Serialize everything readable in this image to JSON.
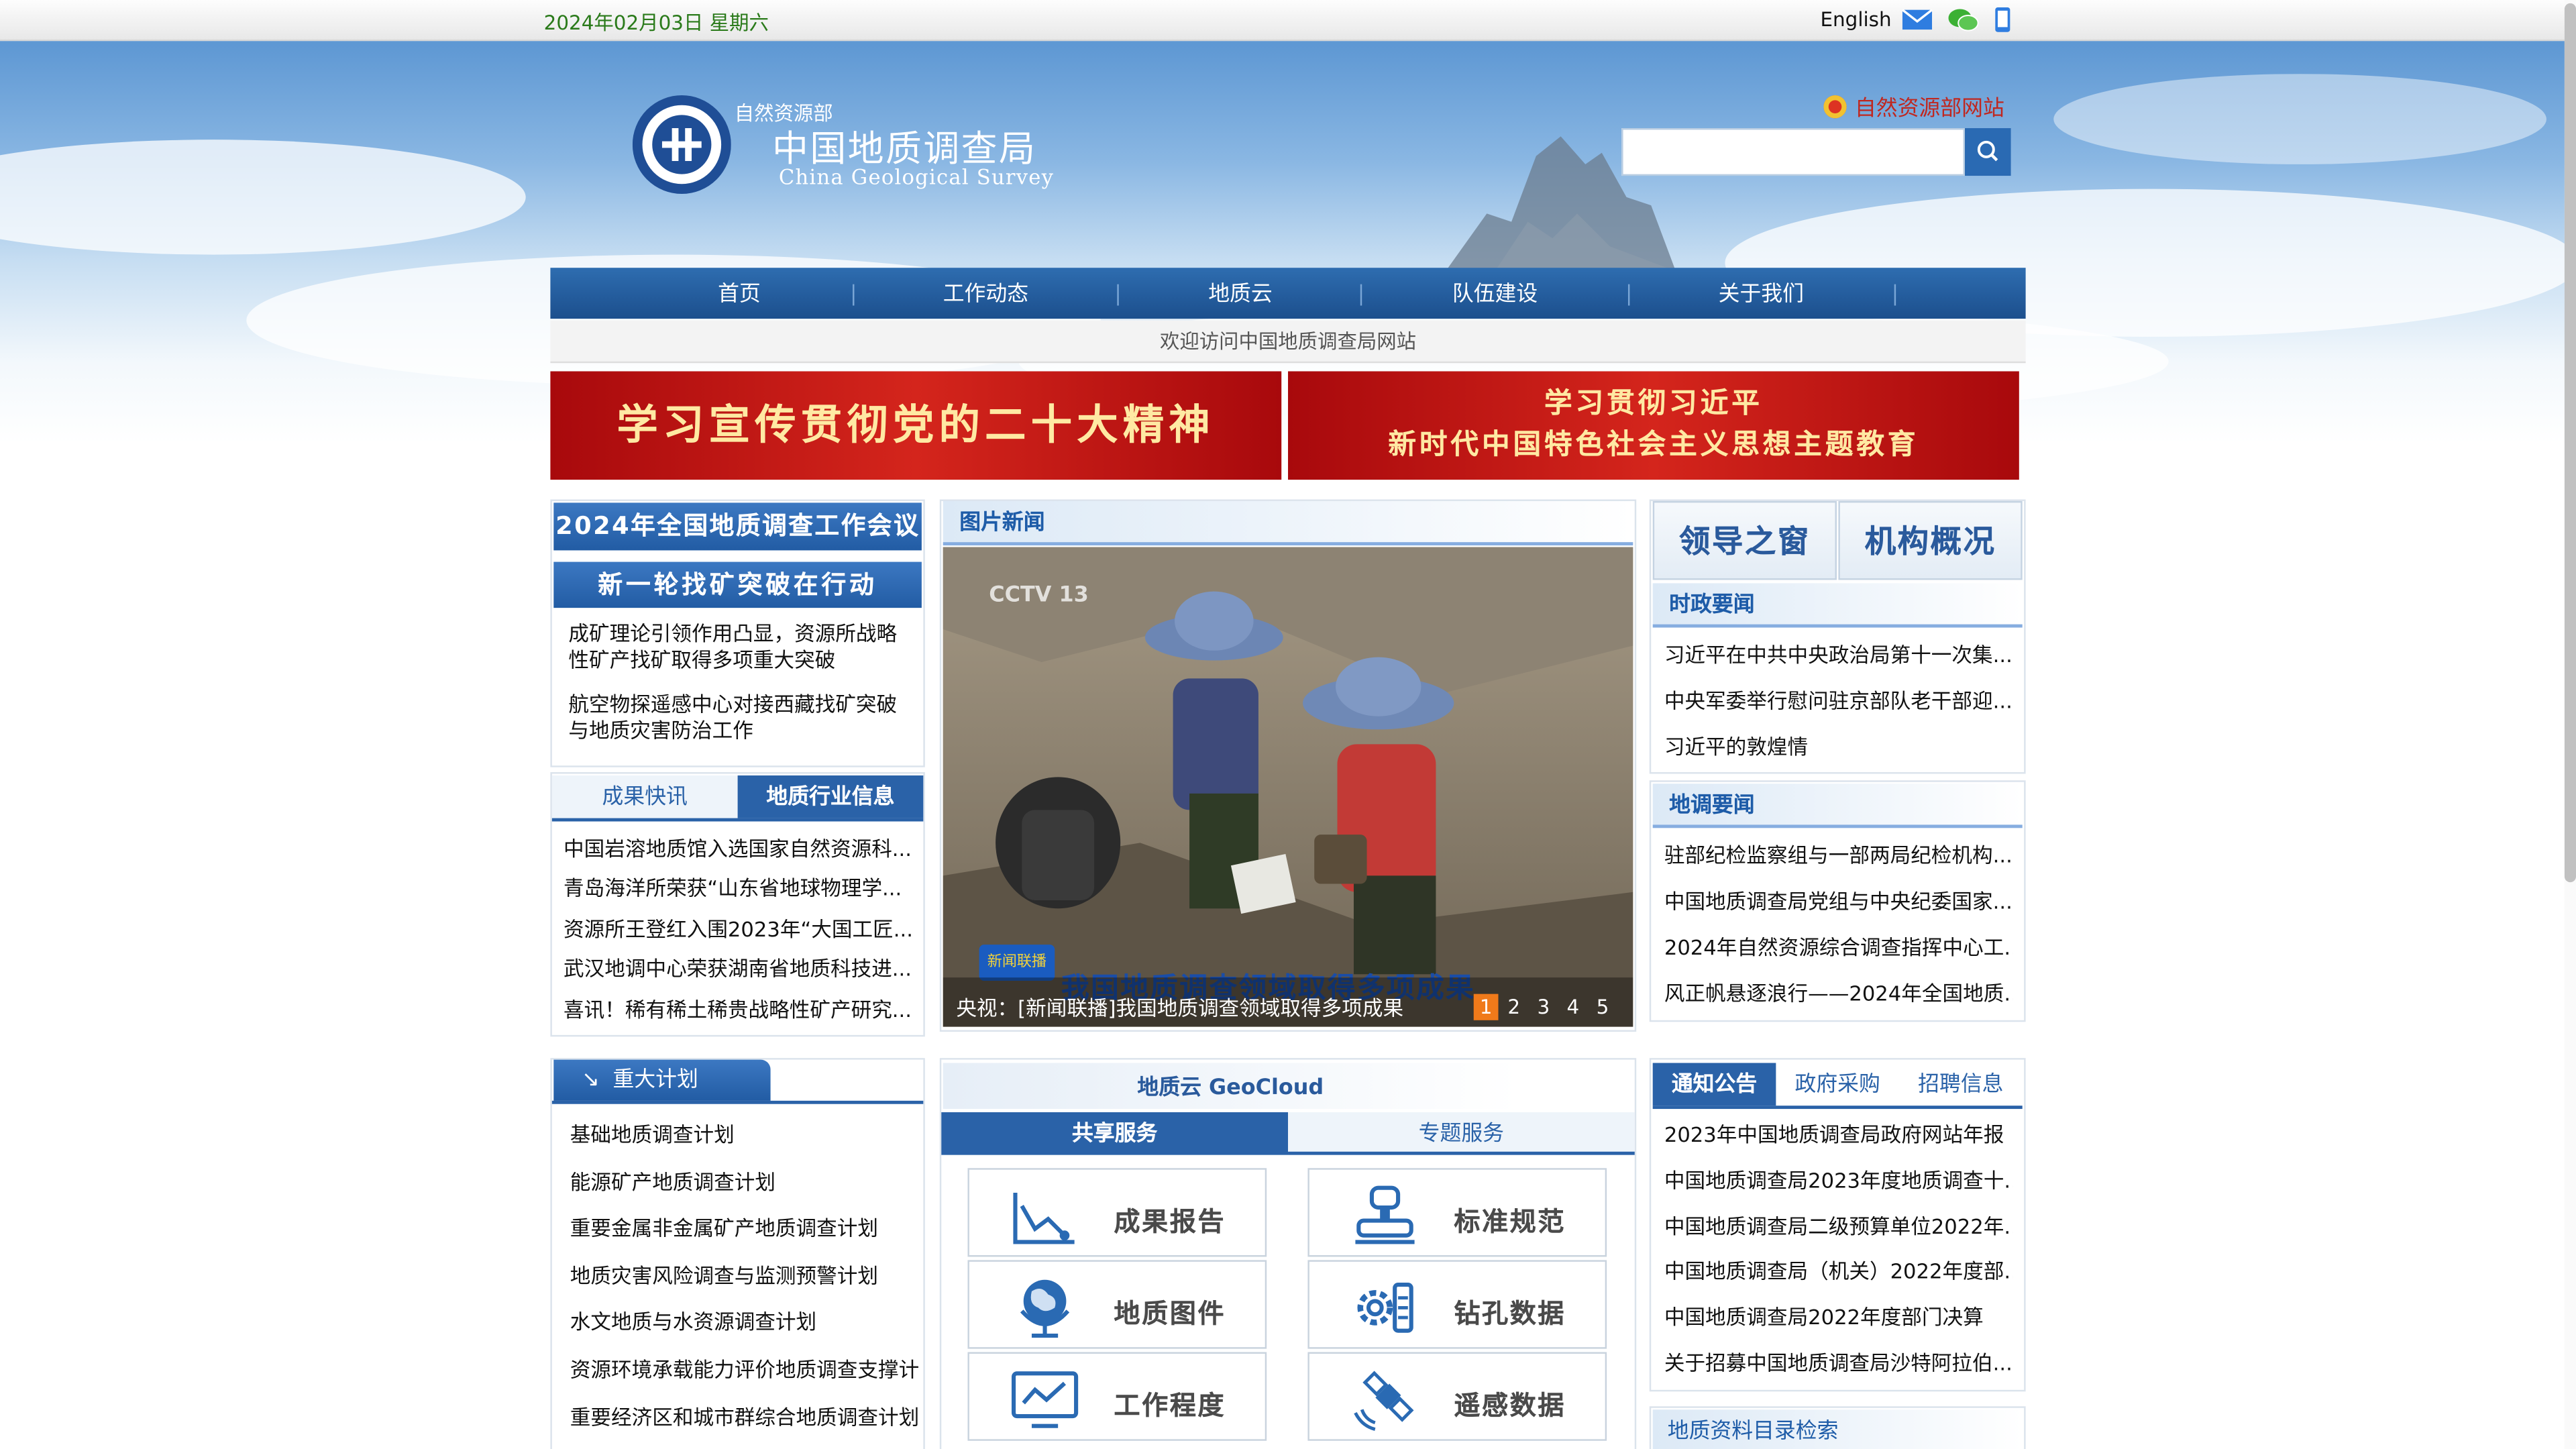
{
  "topbar": {
    "date": "2024年02月03日 星期六",
    "english": "English",
    "icons": [
      "mail-icon",
      "wechat-icon",
      "mobile-icon"
    ]
  },
  "header": {
    "logo_sub": "自然资源部",
    "logo_cn": "中国地质调查局",
    "logo_en": "China Geological Survey",
    "mnr_link": "自然资源部网站",
    "search_placeholder": ""
  },
  "nav": {
    "items": [
      "首页",
      "工作动态",
      "地质云",
      "队伍建设",
      "关于我们"
    ]
  },
  "welcome": "欢迎访问中国地质调查局网站",
  "banners": {
    "left": "学习宣传贯彻党的二十大精神",
    "right_line1": "学习贯彻习近平",
    "right_line2": "新时代中国特色社会主义思想主题教育"
  },
  "left": {
    "conference": "2024年全国地质调查工作会议",
    "breakthrough": "新一轮找矿突破在行动",
    "features": [
      "成矿理论引领作用凸显，资源所战略性矿产找矿取得多项重大突破",
      "航空物探遥感中心对接西藏找矿突破与地质灾害防治工作"
    ],
    "tabs": [
      "成果快讯",
      "地质行业信息"
    ],
    "news": [
      "中国岩溶地质馆入选国家自然资源科...",
      "青岛海洋所荣获“山东省地球物理学...",
      "资源所王登红入围2023年“大国工匠...",
      "武汉地调中心荣获湖南省地质科技进...",
      "喜讯！稀有稀土稀贵战略性矿产研究..."
    ],
    "plans_title": "重大计划",
    "plans": [
      "基础地质调查计划",
      "能源矿产地质调查计划",
      "重要金属非金属矿产地质调查计划",
      "地质灾害风险调查与监测预警计划",
      "水文地质与水资源调查计划",
      "资源环境承载能力评价地质调查支撑计",
      "重要经济区和城市群综合地质调查计划"
    ]
  },
  "center": {
    "photo_title": "图片新闻",
    "caption": "央视：[新闻联播]我国地质调查领域取得多项成果",
    "tv_logo": "CCTV 13",
    "news_logo": "新闻联播",
    "overlay": "我国地质调查领域取得多项成果",
    "pages": [
      "1",
      "2",
      "3",
      "4",
      "5"
    ],
    "geocloud": "地质云 GeoCloud",
    "tabs": [
      "共享服务",
      "专题服务"
    ],
    "services": [
      "成果报告",
      "标准规范",
      "地质图件",
      "钻孔数据",
      "工作程度",
      "遥感数据"
    ]
  },
  "right": {
    "btn_leaders": "领导之窗",
    "btn_org": "机构概况",
    "politics_title": "时政要闻",
    "politics": [
      "习近平在中共中央政治局第十一次集...",
      "中央军委举行慰问驻京部队老干部迎...",
      "习近平的敦煌情"
    ],
    "survey_title": "地调要闻",
    "survey": [
      "驻部纪检监察组与一部两局纪检机构...",
      "中国地质调查局党组与中央纪委国家...",
      "2024年自然资源综合调查指挥中心工...",
      "风正帆悬逐浪行——2024年全国地质..."
    ],
    "tabs": [
      "通知公告",
      "政府采购",
      "招聘信息"
    ],
    "notices": [
      "2023年中国地质调查局政府网站年报",
      "中国地质调查局2023年度地质调查十...",
      "中国地质调查局二级预算单位2022年...",
      "中国地质调查局（机关）2022年度部...",
      "中国地质调查局2022年度部门决算",
      "关于招募中国地质调查局沙特阿拉伯..."
    ],
    "catalog": "地质资料目录检索"
  },
  "colors": {
    "nav": "#225ca4",
    "banner": "#c2141a",
    "accent": "#2a62a8"
  }
}
